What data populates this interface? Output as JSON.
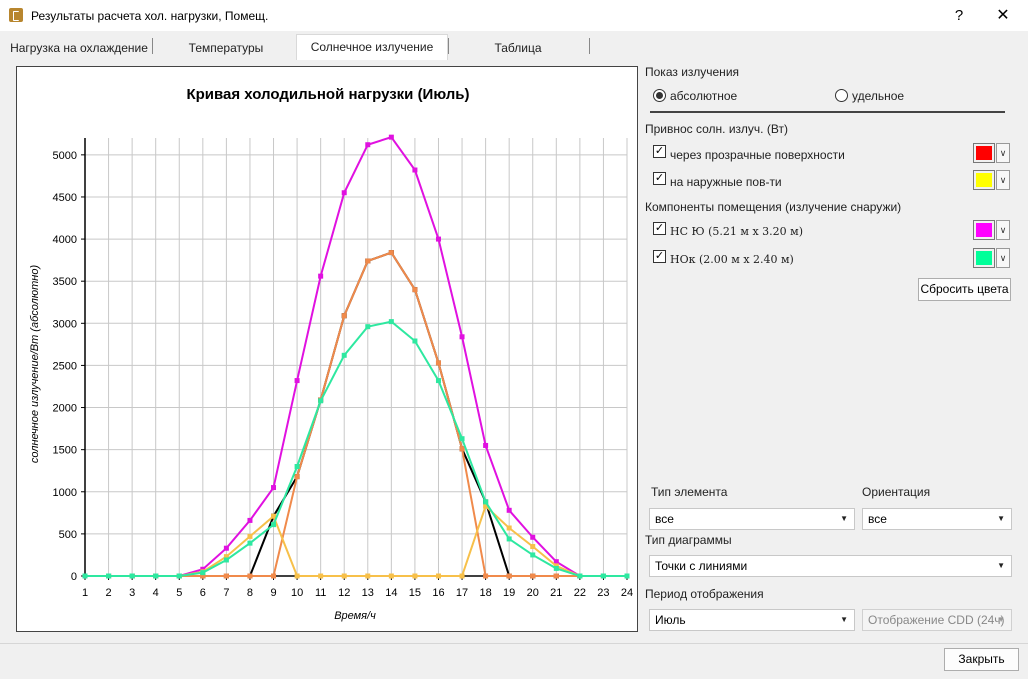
{
  "window": {
    "title": "Результаты расчета хол. нагрузки, Помещ.",
    "help": "?",
    "close": "✕"
  },
  "tabs": [
    {
      "label": "Нагрузка на охлаждение"
    },
    {
      "label": "Температуры"
    },
    {
      "label": "Солнечное излучение",
      "active": true
    },
    {
      "label": "Таблица"
    }
  ],
  "right_panel": {
    "display_header": "Показ излучения",
    "radio_absolute": "абсолютное",
    "radio_specific": "удельное",
    "gain_header": "Привнос солн. излуч. (Вт)",
    "gain_items": [
      {
        "label": "через прозрачные поверхности",
        "checked": true,
        "color": "#ff0000"
      },
      {
        "label": "на наружные пов-ти",
        "checked": true,
        "color": "#ffff00"
      }
    ],
    "components_header": "Компоненты помещения (излучение снаружи)",
    "component_items": [
      {
        "label": "НС Ю (5.21 м x 3.20 м)",
        "checked": true,
        "color": "#ff00ff"
      },
      {
        "label": "НОк (2.00 м x 2.40 м)",
        "checked": true,
        "color": "#00ff99"
      }
    ],
    "reset_colors": "Сбросить цвета",
    "element_type_label": "Тип элемента",
    "element_type_value": "все",
    "orientation_label": "Ориентация",
    "orientation_value": "все",
    "diagram_type_label": "Тип диаграммы",
    "diagram_type_value": "Точки с линиями",
    "period_label": "Период отображения",
    "period_value": "Июль",
    "cdd_value": "Отображение CDD (24ч)"
  },
  "footer": {
    "close_button": "Закрыть"
  },
  "colors": {
    "magenta": "#e011e0",
    "orange": "#f08a4b",
    "green": "#2ee8a0",
    "yellow": "#f7c04a",
    "black": "#000000"
  },
  "chart_data": {
    "type": "line",
    "title": "Кривая холодильной нагрузки (Июль)",
    "xlabel": "Время/ч",
    "ylabel": "солнечное излучение/Вт (абсолютно)",
    "x": [
      1,
      2,
      3,
      4,
      5,
      6,
      7,
      8,
      9,
      10,
      11,
      12,
      13,
      14,
      15,
      16,
      17,
      18,
      19,
      20,
      21,
      22,
      23,
      24
    ],
    "xlim": [
      1,
      24
    ],
    "ylim": [
      0,
      5200
    ],
    "yticks": [
      0,
      500,
      1000,
      1500,
      2000,
      2500,
      3000,
      3500,
      4000,
      4500,
      5000
    ],
    "grid": true,
    "series": [
      {
        "color": "#000000",
        "values": [
          0,
          0,
          0,
          0,
          0,
          0,
          0,
          0,
          710,
          1180,
          2090,
          3090,
          3740,
          3840,
          3400,
          2530,
          1510,
          880,
          0,
          0,
          0,
          0,
          0,
          0
        ]
      },
      {
        "color": "#e011e0",
        "values": [
          0,
          0,
          0,
          0,
          0,
          80,
          330,
          660,
          1050,
          2320,
          3560,
          4550,
          5120,
          5210,
          4820,
          4000,
          2840,
          1550,
          780,
          460,
          170,
          0,
          0,
          0
        ]
      },
      {
        "color": "#f08a4b",
        "values": [
          0,
          0,
          0,
          0,
          0,
          0,
          0,
          0,
          0,
          1180,
          2090,
          3090,
          3740,
          3840,
          3400,
          2530,
          1510,
          0,
          0,
          0,
          0,
          0,
          0,
          0
        ]
      },
      {
        "color": "#f7c04a",
        "values": [
          0,
          0,
          0,
          0,
          0,
          50,
          230,
          470,
          710,
          0,
          0,
          0,
          0,
          0,
          0,
          0,
          0,
          830,
          570,
          350,
          120,
          0,
          0,
          0
        ]
      },
      {
        "color": "#2ee8a0",
        "values": [
          0,
          0,
          0,
          0,
          0,
          40,
          190,
          390,
          610,
          1300,
          2080,
          2620,
          2960,
          3020,
          2790,
          2320,
          1630,
          880,
          440,
          250,
          90,
          0,
          0,
          0
        ]
      }
    ]
  }
}
